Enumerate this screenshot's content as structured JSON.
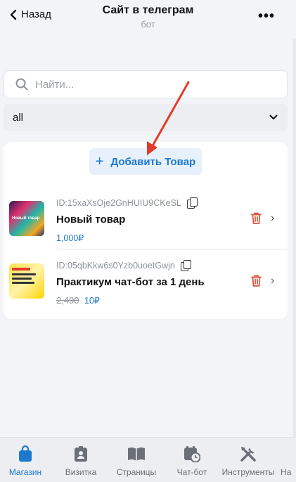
{
  "header": {
    "back_label": "Назад",
    "title": "Сайт в телеграм",
    "subtitle": "бот",
    "more_label": "•••"
  },
  "search": {
    "placeholder": "Найти..."
  },
  "filter": {
    "selected": "all"
  },
  "card": {
    "add_label": "Добавить Товар",
    "products": [
      {
        "id": "ID:15xaXsOje2GnHUIU9CKeSL",
        "name": "Новый товар",
        "old_price": "",
        "price": "1,000₽",
        "thumb_text": "Новый товар"
      },
      {
        "id": "ID:05qbKkw6s0Yzb0uoetGwjn",
        "name": "Практикум чат-бот за 1 день",
        "old_price": "2,490",
        "price": "10₽"
      }
    ]
  },
  "nav": {
    "items": [
      {
        "label": "Магазин",
        "icon": "shopping-bag-icon"
      },
      {
        "label": "Визитка",
        "icon": "id-badge-icon"
      },
      {
        "label": "Страницы",
        "icon": "book-icon"
      },
      {
        "label": "Чат-бот",
        "icon": "calendar-clock-icon"
      },
      {
        "label": "Инструменты",
        "icon": "tools-icon"
      },
      {
        "label": "На",
        "icon": ""
      }
    ]
  },
  "colors": {
    "accent": "#1e78cf",
    "danger": "#e0503a",
    "arrow": "#e53a2b"
  }
}
